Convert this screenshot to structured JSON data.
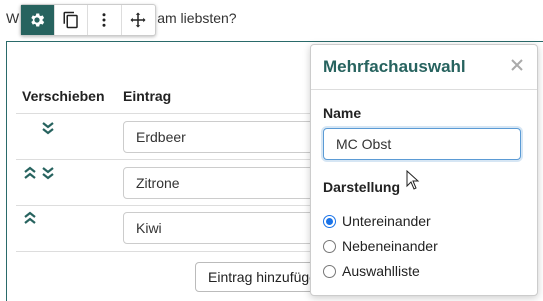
{
  "question": {
    "text": "W ... am liebsten?"
  },
  "toolbar": {
    "buttons": [
      {
        "name": "settings",
        "icon": "gear-icon",
        "active": true
      },
      {
        "name": "copy",
        "icon": "copy-icon",
        "active": false
      },
      {
        "name": "more",
        "icon": "more-vertical-icon",
        "active": false
      },
      {
        "name": "move",
        "icon": "move-arrows-icon",
        "active": false
      }
    ]
  },
  "table": {
    "headers": {
      "move": "Verschieben",
      "entry": "Eintrag"
    },
    "rows": [
      {
        "value": "Erdbeer",
        "up": false,
        "down": true
      },
      {
        "value": "Zitrone",
        "up": true,
        "down": true
      },
      {
        "value": "Kiwi",
        "up": true,
        "down": false
      }
    ],
    "add_label": "Eintrag hinzufügen"
  },
  "popover": {
    "title": "Mehrfachauswahl",
    "name_label": "Name",
    "name_value": "MC Obst",
    "display_label": "Darstellung",
    "options": [
      {
        "label": "Untereinander",
        "checked": true
      },
      {
        "label": "Nebeneinander",
        "checked": false
      },
      {
        "label": "Auswahlliste",
        "checked": false
      }
    ]
  },
  "colors": {
    "accent": "#27635f",
    "focus": "#5b9bd5",
    "radio": "#1a73e8"
  }
}
